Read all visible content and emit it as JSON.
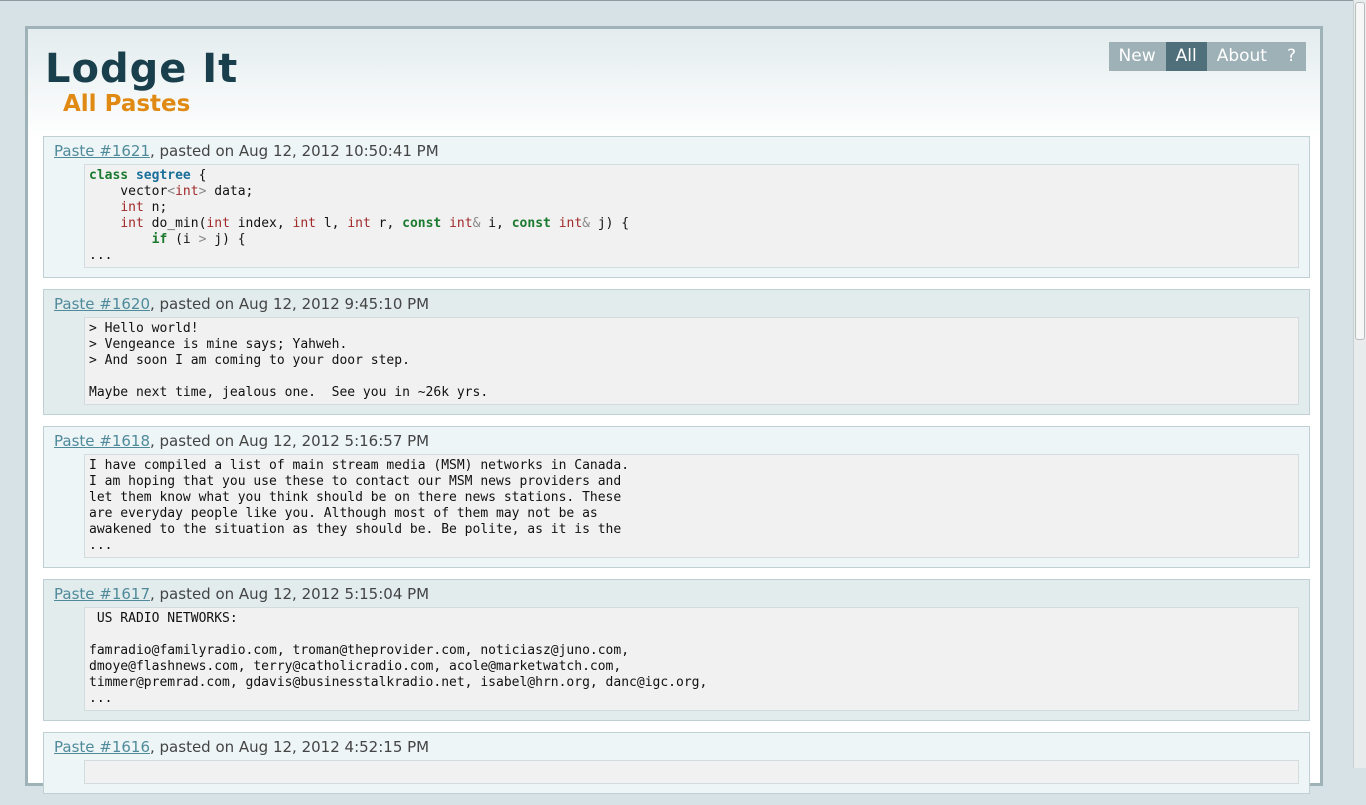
{
  "site": {
    "title": "Lodge It",
    "subtitle": "All Pastes"
  },
  "nav": {
    "items": [
      {
        "label": "New"
      },
      {
        "label": "All",
        "active": true
      },
      {
        "label": "About"
      },
      {
        "label": "?"
      }
    ]
  },
  "pastes": [
    {
      "link": "Paste #1621",
      "date_text": ", pasted on Aug 12, 2012 10:50:41 PM",
      "code_lang": "cpp",
      "code": [
        "class segtree {",
        "    vector<int> data;",
        "    int n;",
        "    int do_min(int index, int l, int r, const int& i, const int& j) {",
        "        if (i > j) {",
        "..."
      ]
    },
    {
      "link": "Paste #1620",
      "date_text": ", pasted on Aug 12, 2012 9:45:10 PM",
      "code": [
        "> Hello world!",
        "> Vengeance is mine says; Yahweh.",
        "> And soon I am coming to your door step.",
        "",
        "Maybe next time, jealous one.  See you in ~26k yrs."
      ]
    },
    {
      "link": "Paste #1618",
      "date_text": ", pasted on Aug 12, 2012 5:16:57 PM",
      "code": [
        "I have compiled a list of main stream media (MSM) networks in Canada.",
        "I am hoping that you use these to contact our MSM news providers and",
        "let them know what you think should be on there news stations. These",
        "are everyday people like you. Although most of them may not be as",
        "awakened to the situation as they should be. Be polite, as it is the",
        "..."
      ]
    },
    {
      "link": "Paste #1617",
      "date_text": ", pasted on Aug 12, 2012 5:15:04 PM",
      "code": [
        " US RADIO NETWORKS:",
        "",
        "famradio@familyradio.com, troman@theprovider.com, noticiasz@juno.com,",
        "dmoye@flashnews.com, terry@catholicradio.com, acole@marketwatch.com,",
        "timmer@premrad.com, gdavis@businesstalkradio.net, isabel@hrn.org, danc@igc.org,",
        "..."
      ]
    },
    {
      "link": "Paste #1616",
      "date_text": ", pasted on Aug 12, 2012 4:52:15 PM",
      "code": [
        ""
      ]
    }
  ]
}
